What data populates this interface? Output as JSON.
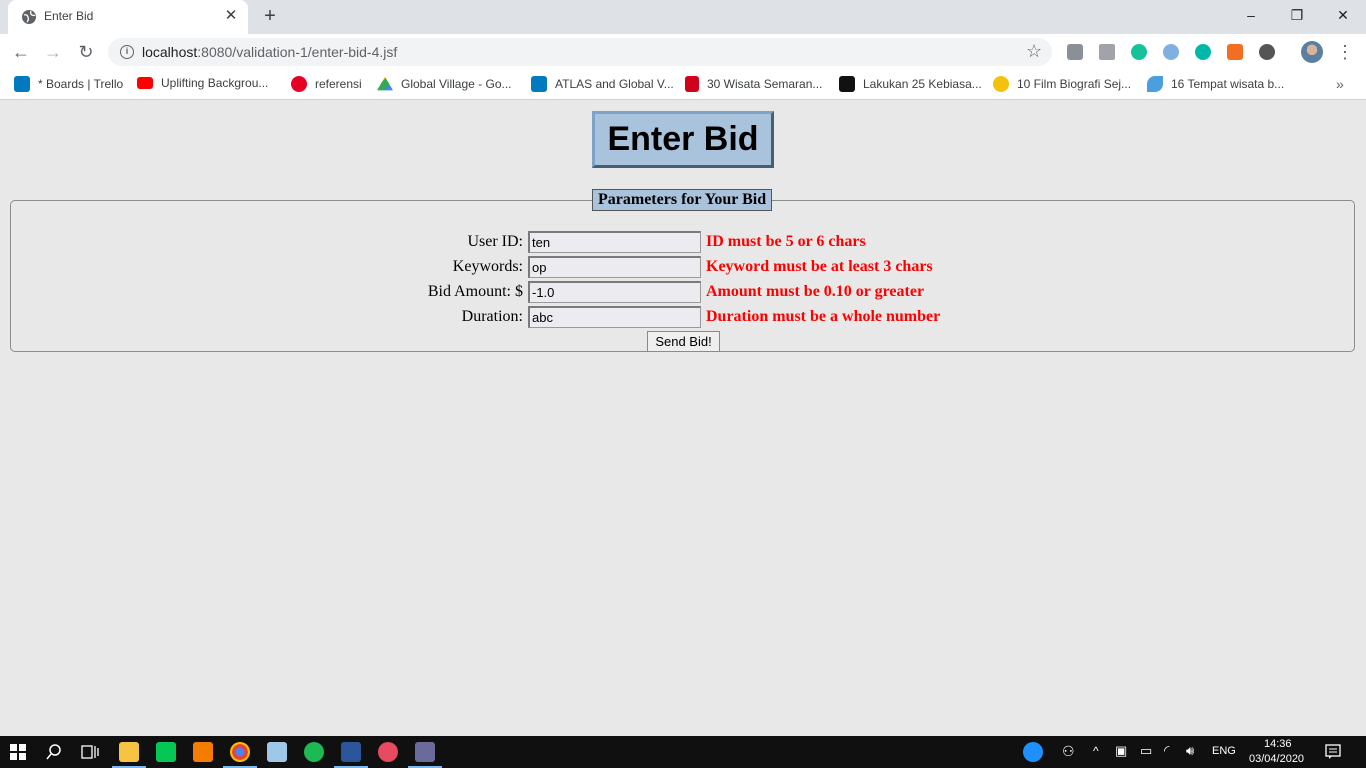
{
  "browser": {
    "tab_title": "Enter Bid",
    "tab_close": "✕",
    "new_tab": "+",
    "url_host": "localhost",
    "url_rest": ":8080/validation-1/enter-bid-4.jsf",
    "window_controls": {
      "minimize": "–",
      "restore": "❐",
      "close": "✕"
    },
    "bookmarks": [
      {
        "label": "* Boards | Trello",
        "icon": "trello-icon",
        "color": "#0079bf"
      },
      {
        "label": "Uplifting Backgrou...",
        "icon": "youtube-icon",
        "color": "#ff0000"
      },
      {
        "label": "referensi",
        "icon": "pinterest-icon",
        "color": "#e60023"
      },
      {
        "label": "Global Village - Go...",
        "icon": "google-drive-icon",
        "color": "#34a853"
      },
      {
        "label": "ATLAS and Global V...",
        "icon": "trello-icon",
        "color": "#0079bf"
      },
      {
        "label": "30 Wisata Semaran...",
        "icon": "m-icon",
        "color": "#d0021b"
      },
      {
        "label": "Lakukan 25 Kebiasa...",
        "icon": "m-icon",
        "color": "#111111"
      },
      {
        "label": "10 Film Biografi Sej...",
        "icon": "z-icon",
        "color": "#f4c20d"
      },
      {
        "label": "16 Tempat wisata b...",
        "icon": "bird-icon",
        "color": "#4a9fe0"
      }
    ],
    "bookmarks_more": "»"
  },
  "page": {
    "title": "Enter Bid",
    "legend": "Parameters for Your Bid",
    "fields": [
      {
        "label": "User ID:",
        "value": "ten",
        "error": "ID must be 5 or 6 chars"
      },
      {
        "label": "Keywords:",
        "value": "op",
        "error": "Keyword must be at least 3 chars"
      },
      {
        "label": "Bid Amount: $",
        "value": "-1.0",
        "error": "Amount must be 0.10 or greater"
      },
      {
        "label": "Duration:",
        "value": "abc",
        "error": "Duration must be a whole number"
      }
    ],
    "submit_label": "Send Bid!"
  },
  "taskbar": {
    "language": "ENG",
    "time": "14:36",
    "date": "03/04/2020"
  },
  "colors": {
    "error": "#ff0000",
    "title_bg": "#a9c3dd",
    "page_bg": "#e8e8e8"
  }
}
